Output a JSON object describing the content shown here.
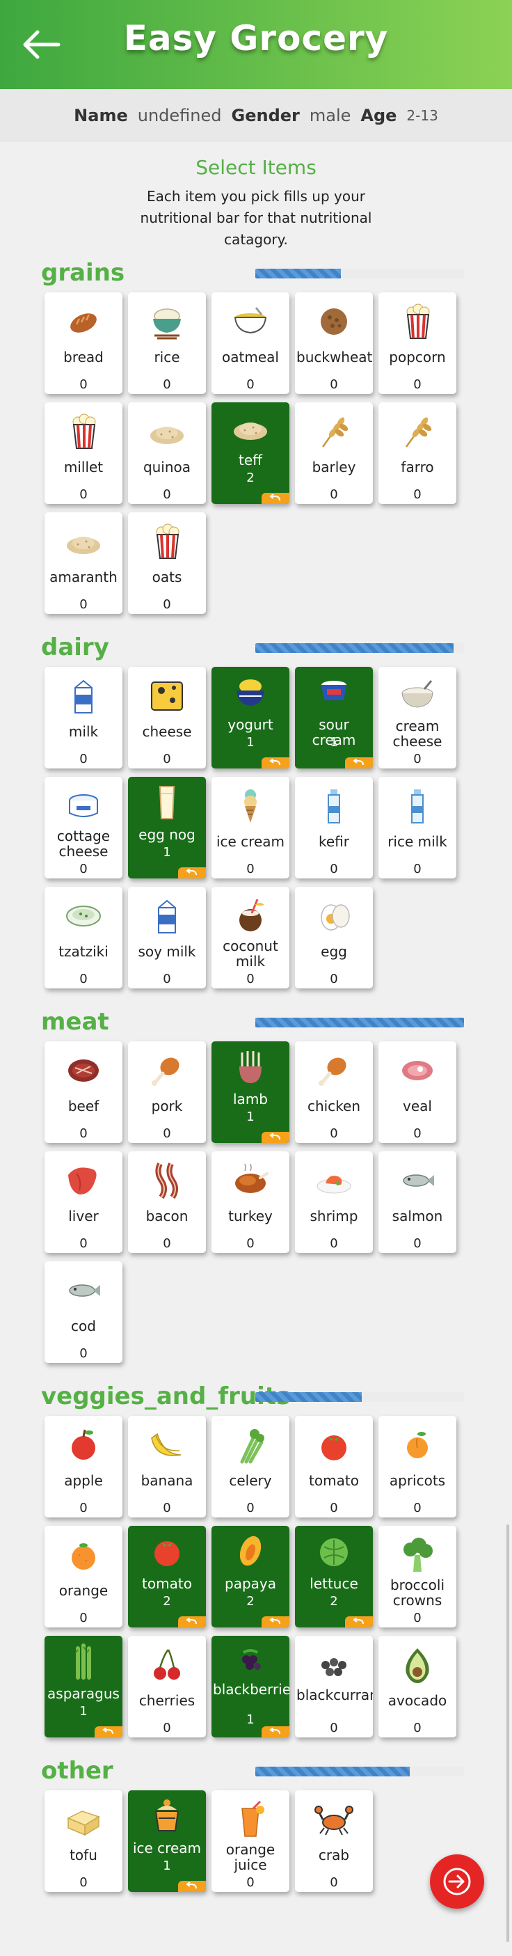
{
  "header": {
    "title": "Easy Grocery",
    "back_icon": "arrow-left-icon"
  },
  "profile": {
    "name_label": "Name",
    "name_value": "undefined",
    "gender_label": "Gender",
    "gender_value": "male",
    "age_label": "Age",
    "age_value": "2-13"
  },
  "intro": {
    "title": "Select Items",
    "text": "Each item you pick fills up your nutritional bar for that nutritional catagory."
  },
  "colors": {
    "header_start": "#3ea83f",
    "header_end": "#8bd255",
    "selected_card": "#196d19",
    "badge": "#f5a11b",
    "bar": "#3f83c8",
    "next_button": "#e52524",
    "category_title": "#55b046"
  },
  "categories": [
    {
      "title": "grains",
      "fill_percent": 41,
      "items": [
        {
          "name": "bread",
          "count": "0",
          "icon": "bread-icon",
          "selected": false
        },
        {
          "name": "rice",
          "count": "0",
          "icon": "rice-bowl-icon",
          "selected": false
        },
        {
          "name": "oatmeal",
          "count": "0",
          "icon": "oatmeal-bowl-icon",
          "selected": false
        },
        {
          "name": "buckwheat",
          "count": "0",
          "icon": "buckwheat-pile-icon",
          "selected": false
        },
        {
          "name": "popcorn",
          "count": "0",
          "icon": "popcorn-icon",
          "selected": false
        },
        {
          "name": "millet",
          "count": "0",
          "icon": "popcorn-icon",
          "selected": false
        },
        {
          "name": "quinoa",
          "count": "0",
          "icon": "grain-pile-icon",
          "selected": false
        },
        {
          "name": "teff",
          "count": "2",
          "icon": "grain-pile-icon",
          "selected": true
        },
        {
          "name": "barley",
          "count": "0",
          "icon": "wheat-ear-icon",
          "selected": false
        },
        {
          "name": "farro",
          "count": "0",
          "icon": "wheat-ear-icon",
          "selected": false
        },
        {
          "name": "amaranth",
          "count": "0",
          "icon": "grain-pile-icon",
          "selected": false
        },
        {
          "name": "oats",
          "count": "0",
          "icon": "popcorn-icon",
          "selected": false
        }
      ]
    },
    {
      "title": "dairy",
      "fill_percent": 95,
      "items": [
        {
          "name": "milk",
          "count": "0",
          "icon": "milk-carton-icon",
          "selected": false
        },
        {
          "name": "cheese",
          "count": "0",
          "icon": "cheese-icon",
          "selected": false
        },
        {
          "name": "yogurt",
          "count": "1",
          "icon": "yogurt-bowl-icon",
          "selected": true
        },
        {
          "name": "sour cream",
          "count": "1",
          "icon": "sour-cream-cup-icon",
          "selected": true
        },
        {
          "name": "cream cheese",
          "count": "0",
          "icon": "cream-bowl-icon",
          "selected": false
        },
        {
          "name": "cottage cheese",
          "count": "0",
          "icon": "cottage-cheese-tub-icon",
          "selected": false
        },
        {
          "name": "egg nog",
          "count": "1",
          "icon": "glass-icon",
          "selected": true
        },
        {
          "name": "ice cream",
          "count": "0",
          "icon": "ice-cream-cone-icon",
          "selected": false
        },
        {
          "name": "kefir",
          "count": "0",
          "icon": "bottle-icon",
          "selected": false
        },
        {
          "name": "rice milk",
          "count": "0",
          "icon": "bottle-icon",
          "selected": false
        },
        {
          "name": "tzatziki",
          "count": "0",
          "icon": "tzatziki-tub-icon",
          "selected": false
        },
        {
          "name": "soy milk",
          "count": "0",
          "icon": "milk-carton-icon",
          "selected": false
        },
        {
          "name": "coconut milk",
          "count": "0",
          "icon": "coconut-drink-icon",
          "selected": false
        },
        {
          "name": "egg",
          "count": "0",
          "icon": "egg-icon",
          "selected": false
        }
      ]
    },
    {
      "title": "meat",
      "fill_percent": 100,
      "items": [
        {
          "name": "beef",
          "count": "0",
          "icon": "steak-icon",
          "selected": false
        },
        {
          "name": "pork",
          "count": "0",
          "icon": "drumstick-icon",
          "selected": false
        },
        {
          "name": "lamb",
          "count": "1",
          "icon": "rack-of-lamb-icon",
          "selected": true
        },
        {
          "name": "chicken",
          "count": "0",
          "icon": "drumstick-icon",
          "selected": false
        },
        {
          "name": "veal",
          "count": "0",
          "icon": "meat-cut-icon",
          "selected": false
        },
        {
          "name": "liver",
          "count": "0",
          "icon": "liver-icon",
          "selected": false
        },
        {
          "name": "bacon",
          "count": "0",
          "icon": "bacon-icon",
          "selected": false
        },
        {
          "name": "turkey",
          "count": "0",
          "icon": "roast-turkey-icon",
          "selected": false
        },
        {
          "name": "shrimp",
          "count": "0",
          "icon": "shrimp-plate-icon",
          "selected": false
        },
        {
          "name": "salmon",
          "count": "0",
          "icon": "fish-icon",
          "selected": false
        },
        {
          "name": "cod",
          "count": "0",
          "icon": "fish-icon",
          "selected": false
        }
      ]
    },
    {
      "title": "veggies_and_fruits",
      "fill_percent": 51,
      "items": [
        {
          "name": "apple",
          "count": "0",
          "icon": "apple-icon",
          "selected": false
        },
        {
          "name": "banana",
          "count": "0",
          "icon": "banana-icon",
          "selected": false
        },
        {
          "name": "celery",
          "count": "0",
          "icon": "celery-icon",
          "selected": false
        },
        {
          "name": "tomato",
          "count": "0",
          "icon": "tomato-icon",
          "selected": false
        },
        {
          "name": "apricots",
          "count": "0",
          "icon": "apricot-icon",
          "selected": false
        },
        {
          "name": "orange",
          "count": "0",
          "icon": "orange-icon",
          "selected": false
        },
        {
          "name": "tomato",
          "count": "2",
          "icon": "tomato-icon",
          "selected": true
        },
        {
          "name": "papaya",
          "count": "2",
          "icon": "papaya-icon",
          "selected": true
        },
        {
          "name": "lettuce",
          "count": "2",
          "icon": "lettuce-icon",
          "selected": true
        },
        {
          "name": "broccoli crowns",
          "count": "0",
          "icon": "broccoli-icon",
          "selected": false
        },
        {
          "name": "asparagus",
          "count": "1",
          "icon": "asparagus-icon",
          "selected": true
        },
        {
          "name": "cherries",
          "count": "0",
          "icon": "cherries-icon",
          "selected": false
        },
        {
          "name": "blackberries",
          "count": "1",
          "icon": "blackberries-icon",
          "selected": true
        },
        {
          "name": "blackcurrants",
          "count": "0",
          "icon": "blackcurrants-icon",
          "selected": false
        },
        {
          "name": "avocado",
          "count": "0",
          "icon": "avocado-icon",
          "selected": false
        }
      ]
    },
    {
      "title": "other",
      "fill_percent": 74,
      "items": [
        {
          "name": "tofu",
          "count": "0",
          "icon": "tofu-icon",
          "selected": false
        },
        {
          "name": "ice cream",
          "count": "1",
          "icon": "ice-cream-cup-icon",
          "selected": true
        },
        {
          "name": "orange juice",
          "count": "0",
          "icon": "juice-glass-icon",
          "selected": false
        },
        {
          "name": "crab",
          "count": "0",
          "icon": "crab-icon",
          "selected": false
        }
      ]
    }
  ],
  "next_button_icon": "arrow-right-icon"
}
